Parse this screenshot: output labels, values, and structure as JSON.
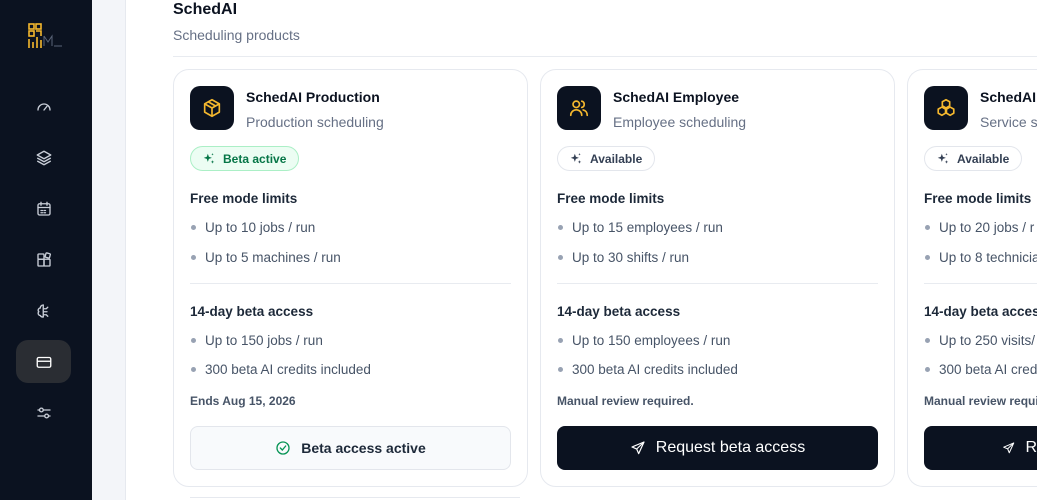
{
  "sidebar": {
    "logo": "company-logo",
    "items": [
      {
        "name": "dashboard",
        "icon": "gauge-icon"
      },
      {
        "name": "products",
        "icon": "layers-icon"
      },
      {
        "name": "schedule",
        "icon": "calendar-icon"
      },
      {
        "name": "integrations",
        "icon": "apps-icon"
      },
      {
        "name": "ai",
        "icon": "brain-icon"
      },
      {
        "name": "billing",
        "icon": "credit-card-icon",
        "active": true
      },
      {
        "name": "settings",
        "icon": "sliders-icon"
      }
    ]
  },
  "section": {
    "title": "SchedAI",
    "subtitle": "Scheduling products"
  },
  "cards": [
    {
      "icon": "cube-icon",
      "name": "SchedAI Production",
      "description": "Production scheduling",
      "badge": "Beta active",
      "free_title": "Free mode limits",
      "free_items": [
        "Up to 10 jobs / run",
        "Up to 5 machines / run"
      ],
      "beta_title": "14-day beta access",
      "beta_items": [
        "Up to 150 jobs / run",
        "300 beta AI credits included"
      ],
      "note": "Ends Aug 15, 2026",
      "cta": "Beta access active"
    },
    {
      "icon": "users-icon",
      "name": "SchedAI Employee",
      "description": "Employee scheduling",
      "badge": "Available",
      "free_title": "Free mode limits",
      "free_items": [
        "Up to 15 employees / run",
        "Up to 30 shifts / run"
      ],
      "beta_title": "14-day beta access",
      "beta_items": [
        "Up to 150 employees / run",
        "300 beta AI credits included"
      ],
      "note": "Manual review required.",
      "cta": "Request beta access"
    },
    {
      "icon": "boxes-icon",
      "name": "SchedAI S",
      "description": "Service sc",
      "badge": "Available",
      "free_title": "Free mode limits",
      "free_items": [
        "Up to 20 jobs / r",
        "Up to 8 technicia"
      ],
      "beta_title": "14-day beta access",
      "beta_items": [
        "Up to 250 visits/",
        "300 beta AI cred"
      ],
      "note": "Manual review requir",
      "cta": "R"
    }
  ],
  "colors": {
    "sidebar_bg": "#0b1220",
    "accent_gold": "#f5b82e",
    "beta_green": "#067647"
  }
}
